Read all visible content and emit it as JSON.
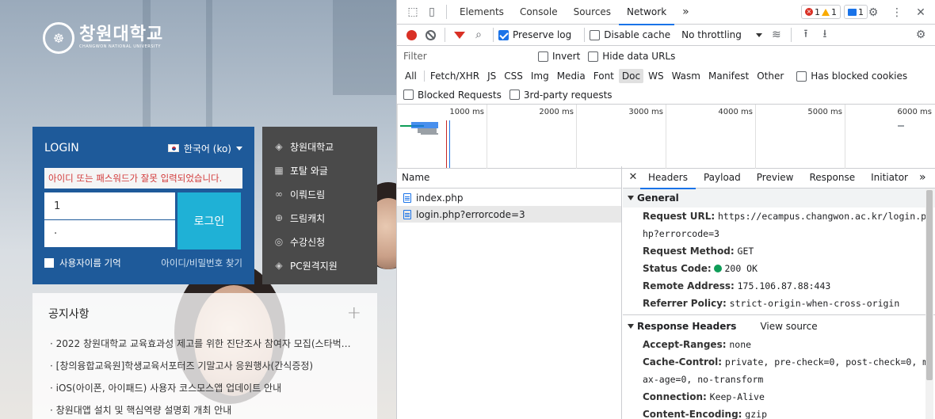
{
  "site": {
    "logo": {
      "name": "창원대학교",
      "sub": "CHANGWON NATIONAL UNIVERSITY"
    },
    "login": {
      "title": "LOGIN",
      "language": "한국어 (ko)",
      "error": "아이디 또는 패스워드가 잘못 입력되었습니다.",
      "id_value": "1",
      "pw_value": "·",
      "button": "로그인",
      "remember": "사용자이름 기억",
      "find": "아이디/비밀번호 찾기"
    },
    "quick_links": [
      {
        "label": "창원대학교",
        "icon": "layers-icon"
      },
      {
        "label": "포탈 와글",
        "icon": "film-icon"
      },
      {
        "label": "이뤄드림",
        "icon": "link-icon"
      },
      {
        "label": "드림캐치",
        "icon": "crosshair-icon"
      },
      {
        "label": "수강신청",
        "icon": "globe-icon"
      },
      {
        "label": "PC원격지원",
        "icon": "layers-icon"
      }
    ],
    "notice": {
      "title": "공지사항",
      "items": [
        "2022 창원대학교 교육효과성 제고를 위한 진단조사 참여자 모집(스타벅…",
        "[창의융합교육원]학생교육서포터즈 기말고사 응원행사(간식증정)",
        "iOS(아이폰, 아이패드) 사용자 코스모스앱 업데이트 안내",
        "창원대앱 설치 및 핵심역량 설명회 개최 안내"
      ]
    }
  },
  "devtools": {
    "tabs": [
      "Elements",
      "Console",
      "Sources",
      "Network"
    ],
    "active_tab": "Network",
    "more": "»",
    "badges": {
      "errors": "1",
      "warnings": "1",
      "messages": "1"
    },
    "toolbar": {
      "preserve_log": "Preserve log",
      "disable_cache": "Disable cache",
      "throttling": "No throttling"
    },
    "filter": {
      "placeholder": "Filter",
      "invert": "Invert",
      "hide_data_urls": "Hide data URLs",
      "types": [
        "All",
        "Fetch/XHR",
        "JS",
        "CSS",
        "Img",
        "Media",
        "Font",
        "Doc",
        "WS",
        "Wasm",
        "Manifest",
        "Other"
      ],
      "selected_type": "Doc",
      "has_blocked_cookies": "Has blocked cookies",
      "blocked_requests": "Blocked Requests",
      "third_party": "3rd-party requests"
    },
    "timeline_ticks": [
      "1000 ms",
      "2000 ms",
      "3000 ms",
      "4000 ms",
      "5000 ms",
      "6000 ms"
    ],
    "name_header": "Name",
    "requests": [
      "index.php",
      "login.php?errorcode=3"
    ],
    "detail_tabs": [
      "Headers",
      "Payload",
      "Preview",
      "Response",
      "Initiator"
    ],
    "general": {
      "title": "General",
      "request_url_label": "Request URL:",
      "request_url": "https://ecampus.changwon.ac.kr/login.php?errorcode=3",
      "method_label": "Request Method:",
      "method": "GET",
      "status_label": "Status Code:",
      "status": "200 OK",
      "remote_label": "Remote Address:",
      "remote": "175.106.87.88:443",
      "referrer_label": "Referrer Policy:",
      "referrer": "strict-origin-when-cross-origin"
    },
    "response_headers": {
      "title": "Response Headers",
      "view_source": "View source",
      "accept_ranges_label": "Accept-Ranges:",
      "accept_ranges": "none",
      "cache_control_label": "Cache-Control:",
      "cache_control": "private, pre-check=0, post-check=0, max-age=0, no-transform",
      "connection_label": "Connection:",
      "connection": "Keep-Alive",
      "content_encoding_label": "Content-Encoding:",
      "content_encoding": "gzip"
    }
  }
}
